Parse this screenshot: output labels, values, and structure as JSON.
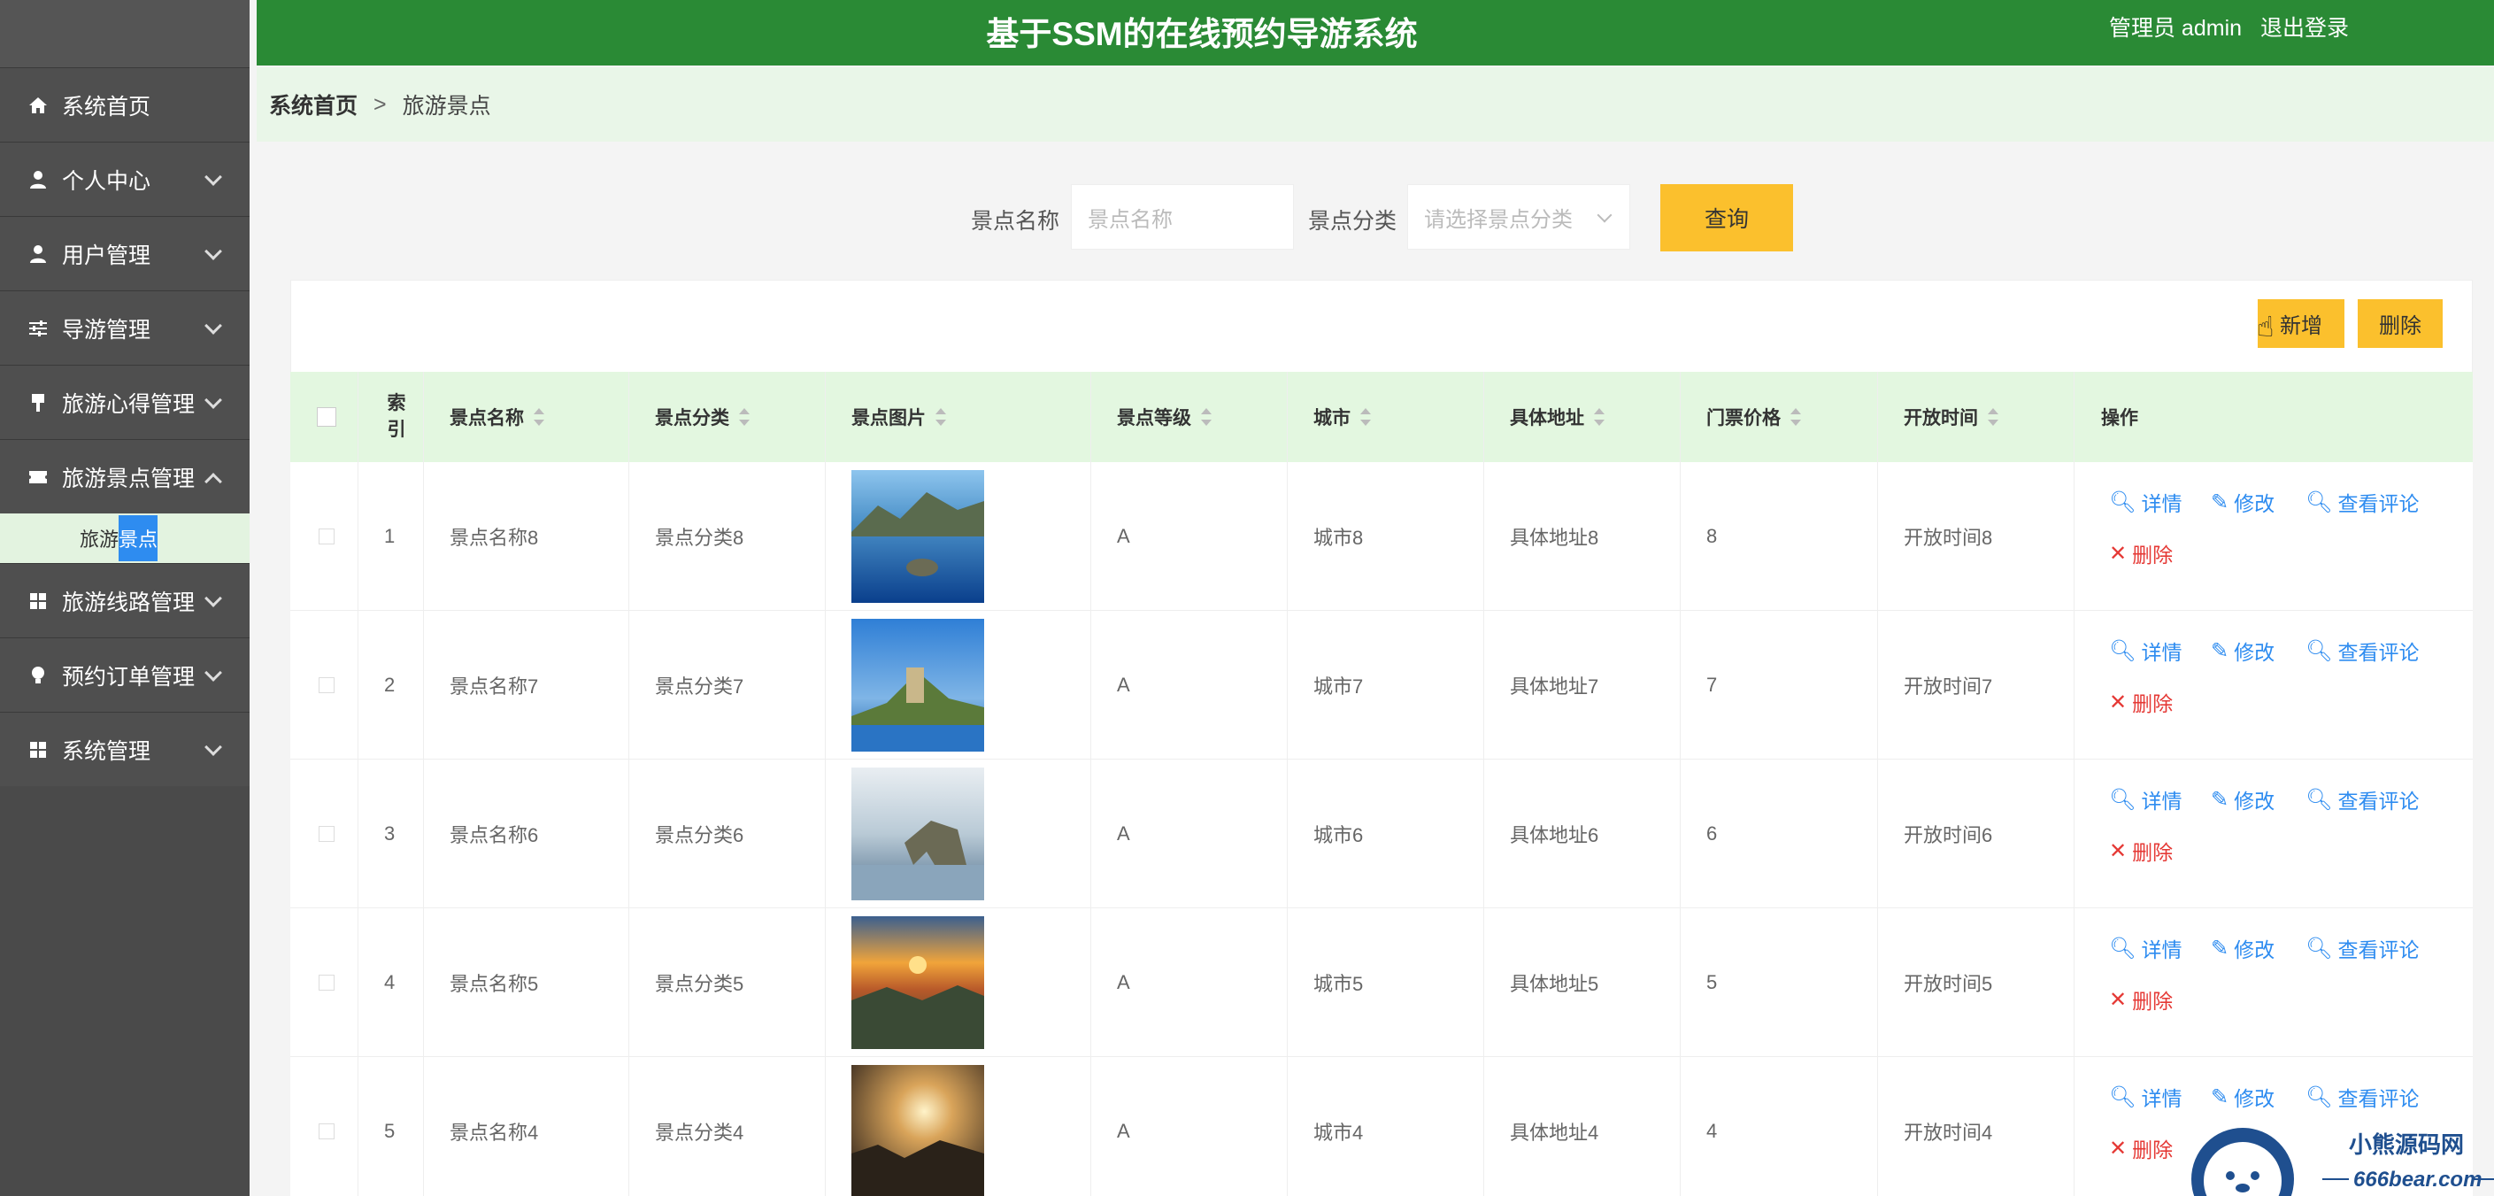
{
  "header": {
    "title": "基于SSM的在线预约导游系统",
    "user": "管理员 admin",
    "logout": "退出登录"
  },
  "sidebar": {
    "items": [
      {
        "label": "系统首页",
        "icon": "home-icon"
      },
      {
        "label": "个人中心",
        "icon": "person-icon"
      },
      {
        "label": "用户管理",
        "icon": "person-icon"
      },
      {
        "label": "导游管理",
        "icon": "sliders-icon"
      },
      {
        "label": "旅游心得管理",
        "icon": "brush-icon"
      },
      {
        "label": "旅游景点管理",
        "icon": "ticket-icon"
      },
      {
        "label": "旅游线路管理",
        "icon": "grid-icon"
      },
      {
        "label": "预约订单管理",
        "icon": "bulb-icon"
      },
      {
        "label": "系统管理",
        "icon": "grid-icon"
      }
    ],
    "sub_item": {
      "label_a": "旅游",
      "label_b": "景点"
    }
  },
  "breadcrumb": {
    "home": "系统首页",
    "sep": ">",
    "current": "旅游景点"
  },
  "search": {
    "name_label": "景点名称",
    "name_placeholder": "景点名称",
    "cat_label": "景点分类",
    "cat_placeholder": "请选择景点分类",
    "query": "查询"
  },
  "toolbar": {
    "add": "新增",
    "delete": "删除"
  },
  "table": {
    "headers": {
      "index": "索引",
      "name": "景点名称",
      "cat": "景点分类",
      "img": "景点图片",
      "level": "景点等级",
      "city": "城市",
      "addr": "具体地址",
      "price": "门票价格",
      "time": "开放时间",
      "ops": "操作"
    },
    "rows": [
      {
        "idx": "1",
        "name": "景点名称8",
        "cat": "景点分类8",
        "level": "A",
        "city": "城市8",
        "addr": "具体地址8",
        "price": "8",
        "time": "开放时间8"
      },
      {
        "idx": "2",
        "name": "景点名称7",
        "cat": "景点分类7",
        "level": "A",
        "city": "城市7",
        "addr": "具体地址7",
        "price": "7",
        "time": "开放时间7"
      },
      {
        "idx": "3",
        "name": "景点名称6",
        "cat": "景点分类6",
        "level": "A",
        "city": "城市6",
        "addr": "具体地址6",
        "price": "6",
        "time": "开放时间6"
      },
      {
        "idx": "4",
        "name": "景点名称5",
        "cat": "景点分类5",
        "level": "A",
        "city": "城市5",
        "addr": "具体地址5",
        "price": "5",
        "time": "开放时间5"
      },
      {
        "idx": "5",
        "name": "景点名称4",
        "cat": "景点分类4",
        "level": "A",
        "city": "城市4",
        "addr": "具体地址4",
        "price": "4",
        "time": "开放时间4"
      }
    ],
    "ops": {
      "detail": "详情",
      "edit": "修改",
      "review": "查看评论",
      "del": "删除"
    }
  },
  "watermark": {
    "brand": "小熊源码网",
    "url": "666bear.com"
  }
}
